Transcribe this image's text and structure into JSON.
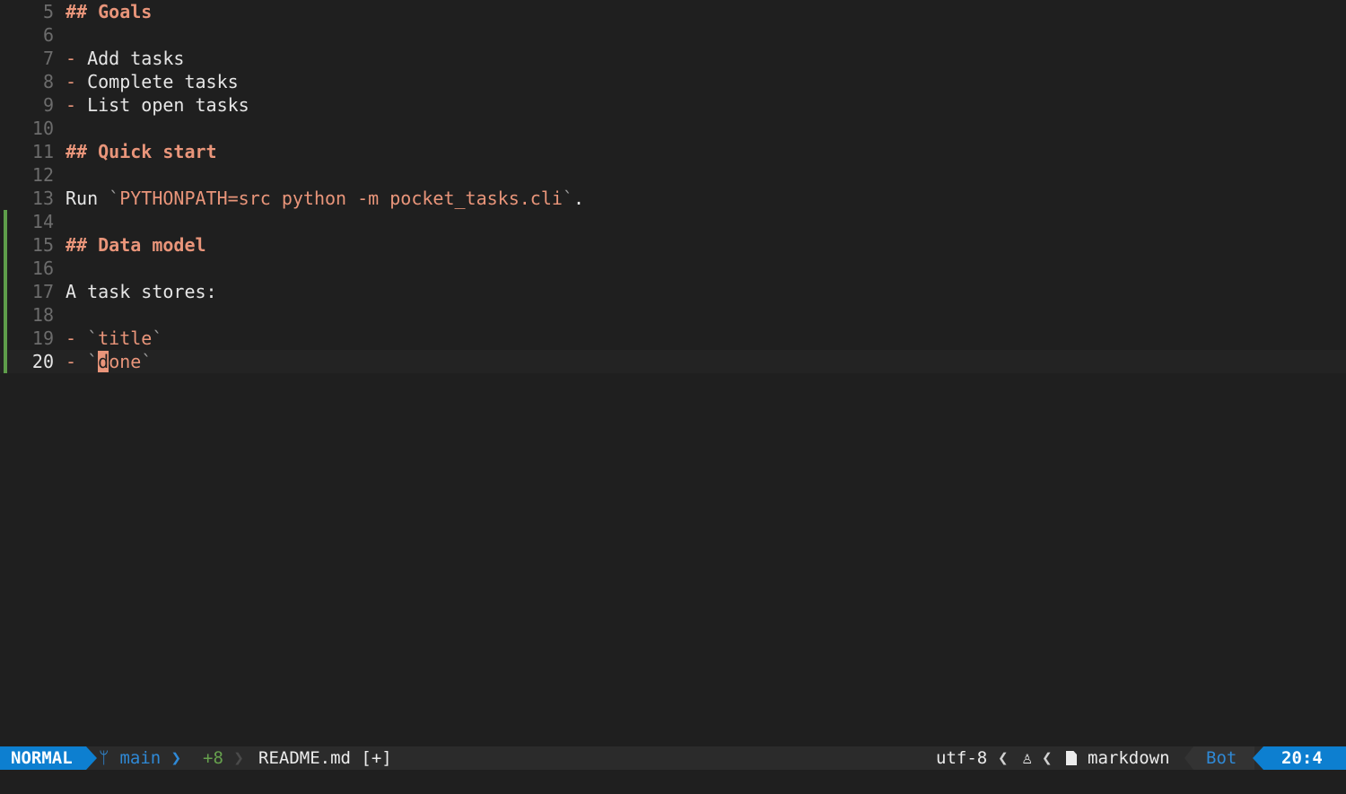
{
  "editor": {
    "lines": [
      {
        "num": "5",
        "parts": [
          {
            "cls": "heading",
            "t": "## Goals"
          }
        ]
      },
      {
        "num": "6",
        "parts": []
      },
      {
        "num": "7",
        "parts": [
          {
            "cls": "bullet",
            "t": "-"
          },
          {
            "cls": "text",
            "t": " Add tasks"
          }
        ]
      },
      {
        "num": "8",
        "parts": [
          {
            "cls": "bullet",
            "t": "-"
          },
          {
            "cls": "text",
            "t": " Complete tasks"
          }
        ]
      },
      {
        "num": "9",
        "parts": [
          {
            "cls": "bullet",
            "t": "-"
          },
          {
            "cls": "text",
            "t": " List open tasks"
          }
        ]
      },
      {
        "num": "10",
        "parts": []
      },
      {
        "num": "11",
        "parts": [
          {
            "cls": "heading",
            "t": "## Quick start"
          }
        ]
      },
      {
        "num": "12",
        "parts": []
      },
      {
        "num": "13",
        "parts": [
          {
            "cls": "text",
            "t": "Run "
          },
          {
            "cls": "tick",
            "t": "`"
          },
          {
            "cls": "code",
            "t": "PYTHONPATH=src python -m pocket_tasks.cli"
          },
          {
            "cls": "tick",
            "t": "`"
          },
          {
            "cls": "text",
            "t": "."
          }
        ]
      },
      {
        "num": "14",
        "parts": [],
        "changed": true
      },
      {
        "num": "15",
        "parts": [
          {
            "cls": "heading",
            "t": "## Data model"
          }
        ],
        "changed": true
      },
      {
        "num": "16",
        "parts": [],
        "changed": true
      },
      {
        "num": "17",
        "parts": [
          {
            "cls": "text",
            "t": "A task stores:"
          }
        ],
        "changed": true
      },
      {
        "num": "18",
        "parts": [],
        "changed": true
      },
      {
        "num": "19",
        "parts": [
          {
            "cls": "bullet",
            "t": "-"
          },
          {
            "cls": "text",
            "t": " "
          },
          {
            "cls": "tick",
            "t": "`"
          },
          {
            "cls": "code",
            "t": "title"
          },
          {
            "cls": "tick",
            "t": "`"
          }
        ],
        "changed": true
      },
      {
        "num": "20",
        "parts": [
          {
            "cls": "bullet",
            "t": "-"
          },
          {
            "cls": "text",
            "t": " "
          },
          {
            "cls": "tick",
            "t": "`"
          },
          {
            "cls": "cursor",
            "t": "d"
          },
          {
            "cls": "code",
            "t": "one"
          },
          {
            "cls": "tick",
            "t": "`"
          }
        ],
        "changed": true,
        "current": true
      }
    ]
  },
  "statusline": {
    "mode": "NORMAL",
    "branch_icon": "git-branch-icon",
    "branch": "main",
    "diff": "+8",
    "file": "README.md [+]",
    "encoding": "utf-8",
    "os_icon": "linux-icon",
    "filetype_icon": "file-icon",
    "filetype": "markdown",
    "position_label": "Bot",
    "cursor_position": "20:4"
  },
  "colors": {
    "background": "#1f1f1f",
    "accent": "#0d7fd0",
    "heading": "#e9957a",
    "git_added": "#5e9d4a"
  }
}
